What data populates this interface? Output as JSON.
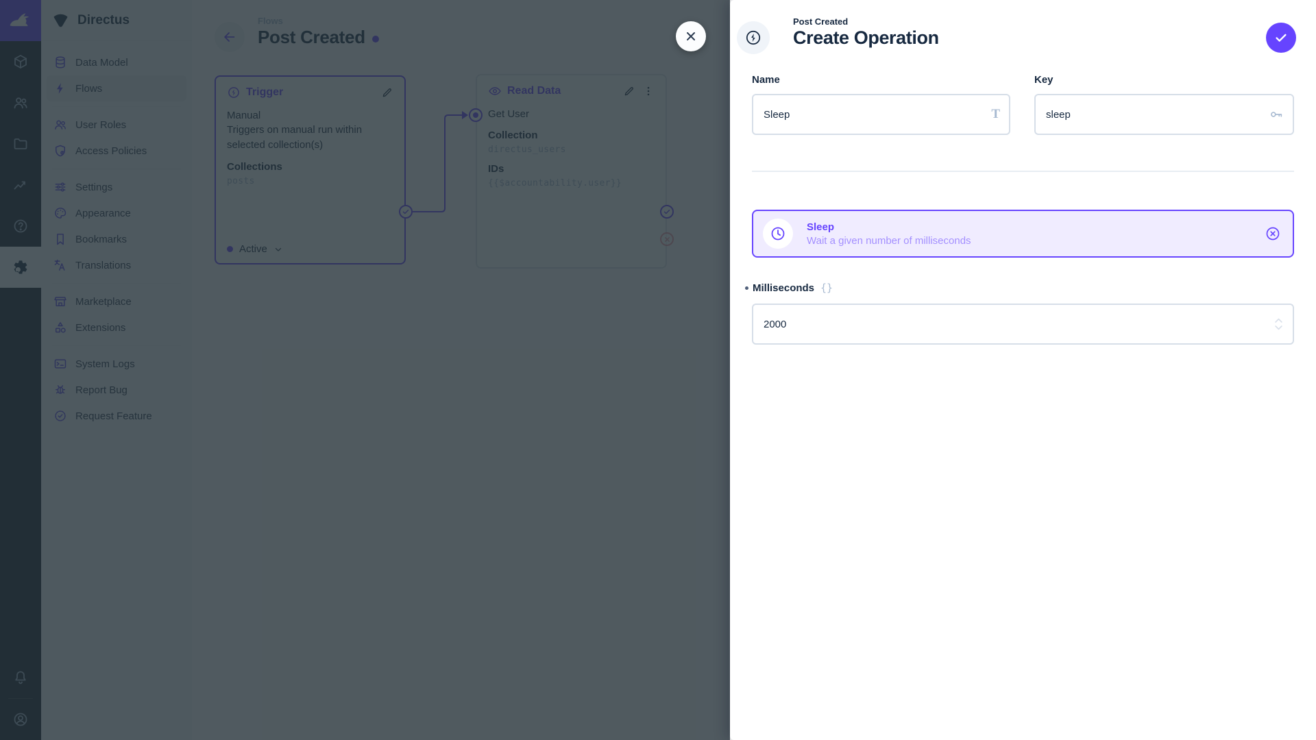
{
  "colors": {
    "primary": "#6644ff",
    "danger": "#e35169",
    "navy": "#172940",
    "sidebar_bg": "#f0f4f9",
    "module_bar_bg": "#18222f",
    "overlay": "rgba(38,50,56,0.8)"
  },
  "icons": {
    "logo": "directus-rabbit",
    "project": "wing",
    "modules": [
      "content-cube",
      "user-directory",
      "file-library",
      "insights",
      "help",
      "settings-gear"
    ],
    "module_bottom": [
      "notifications-bell",
      "account-circle"
    ]
  },
  "sidebar": {
    "project_name": "Directus",
    "items": [
      {
        "label": "Data Model",
        "icon": "database"
      },
      {
        "label": "Flows",
        "icon": "bolt",
        "active": true
      },
      {
        "label": "User Roles",
        "icon": "people"
      },
      {
        "label": "Access Policies",
        "icon": "shield-lock"
      },
      {
        "label": "Settings",
        "icon": "tune"
      },
      {
        "label": "Appearance",
        "icon": "palette"
      },
      {
        "label": "Bookmarks",
        "icon": "bookmark"
      },
      {
        "label": "Translations",
        "icon": "translate"
      },
      {
        "label": "Marketplace",
        "icon": "storefront"
      },
      {
        "label": "Extensions",
        "icon": "shapes"
      },
      {
        "label": "System Logs",
        "icon": "terminal"
      },
      {
        "label": "Report Bug",
        "icon": "bug"
      },
      {
        "label": "Request Feature",
        "icon": "badge-check"
      }
    ]
  },
  "canvas": {
    "breadcrumb": "Flows",
    "flow_title": "Post Created",
    "trigger_panel": {
      "title": "Trigger",
      "type": "Manual",
      "description": "Triggers on manual run within selected collection(s)",
      "field_label": "Collections",
      "field_value": "posts",
      "status": "Active"
    },
    "operation_panel": {
      "title": "Read Data",
      "name": "Get User",
      "fields": [
        {
          "label": "Collection",
          "value": "directus_users"
        },
        {
          "label": "IDs",
          "value": "{{$accountability.user}}"
        }
      ]
    }
  },
  "drawer": {
    "context": "Post Created",
    "title": "Create Operation",
    "name_field": {
      "label": "Name",
      "value": "Sleep",
      "affix_icon": "T"
    },
    "key_field": {
      "label": "Key",
      "value": "sleep"
    },
    "selected_operation": {
      "name": "Sleep",
      "description": "Wait a given number of milliseconds"
    },
    "milliseconds_field": {
      "label": "Milliseconds",
      "value": "2000",
      "raw_icon": "{}"
    }
  }
}
